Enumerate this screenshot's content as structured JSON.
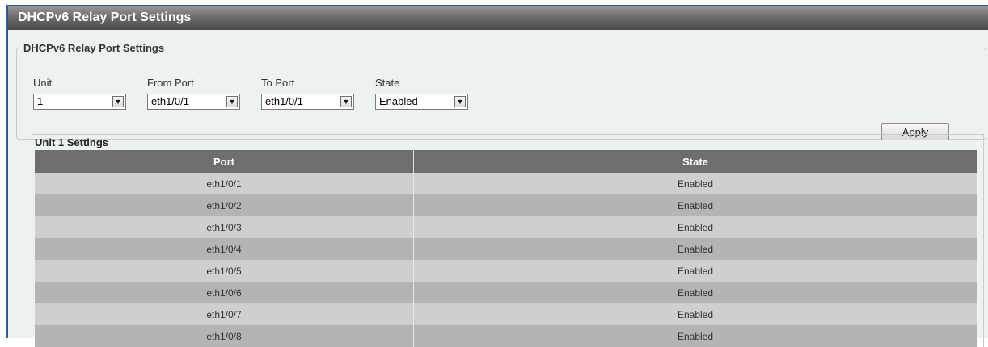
{
  "window": {
    "title": "DHCPv6 Relay Port Settings"
  },
  "settings": {
    "legend": "DHCPv6 Relay Port Settings",
    "unit": {
      "label": "Unit",
      "value": "1"
    },
    "from_port": {
      "label": "From Port",
      "value": "eth1/0/1"
    },
    "to_port": {
      "label": "To Port",
      "value": "eth1/0/1"
    },
    "state": {
      "label": "State",
      "value": "Enabled"
    },
    "apply_label": "Apply"
  },
  "table": {
    "caption": "Unit 1 Settings",
    "columns": [
      "Port",
      "State"
    ],
    "rows": [
      {
        "port": "eth1/0/1",
        "state": "Enabled"
      },
      {
        "port": "eth1/0/2",
        "state": "Enabled"
      },
      {
        "port": "eth1/0/3",
        "state": "Enabled"
      },
      {
        "port": "eth1/0/4",
        "state": "Enabled"
      },
      {
        "port": "eth1/0/5",
        "state": "Enabled"
      },
      {
        "port": "eth1/0/6",
        "state": "Enabled"
      },
      {
        "port": "eth1/0/7",
        "state": "Enabled"
      },
      {
        "port": "eth1/0/8",
        "state": "Enabled"
      }
    ]
  },
  "icons": {
    "dropdown": "chevron-down-icon"
  },
  "colors": {
    "title_bar": "#4b4b4b",
    "header_row": "#6e6e6e",
    "row_light": "#cfcfcf",
    "row_dark": "#b4b4b4",
    "frame_border": "#2d5a9a"
  }
}
